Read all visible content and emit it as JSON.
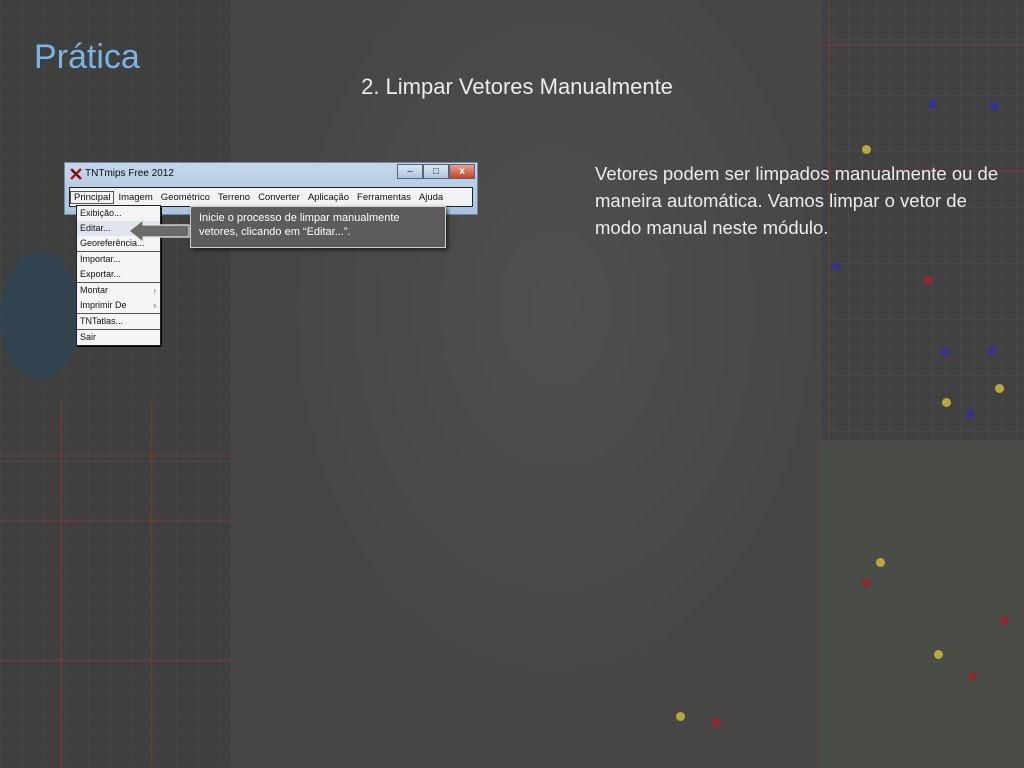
{
  "slide": {
    "title": "Prática",
    "subtitle": "2. Limpar Vetores Manualmente",
    "body": "Vetores podem ser limpados manualmente ou de maneira automática. Vamos  limpar o vetor de modo manual neste módulo."
  },
  "window": {
    "title": "TNTmips Free 2012",
    "icon": "tntmips-app-icon",
    "controls": {
      "minimize": "–",
      "maximize": "□",
      "close": "x"
    },
    "menu": [
      "Principal",
      "Imagem",
      "Geométrico",
      "Terreno",
      "Converter",
      "Aplicação",
      "Ferramentas",
      "Ajuda"
    ],
    "active_menu": "Principal"
  },
  "dropdown": {
    "items": [
      {
        "label": "Exibição..."
      },
      {
        "label": "Editar..."
      },
      {
        "label": "Georeferência..."
      },
      {
        "label": "Importar..."
      },
      {
        "label": "Exportar..."
      },
      {
        "label": "Montar"
      },
      {
        "label": "Imprimir De"
      },
      {
        "label": "TNTatlas..."
      },
      {
        "label": "Sair"
      }
    ],
    "submenu_arrow": "›"
  },
  "callout": {
    "text": "Inicie o processo de limpar manualmente vetores, clicando em “Editar...”.",
    "pointer_icon": "left-arrow-icon"
  },
  "colors": {
    "title": "#79b4e6",
    "text": "#ededed",
    "background": "#3a3b3a",
    "callout_bg": "#5c5c5c"
  }
}
